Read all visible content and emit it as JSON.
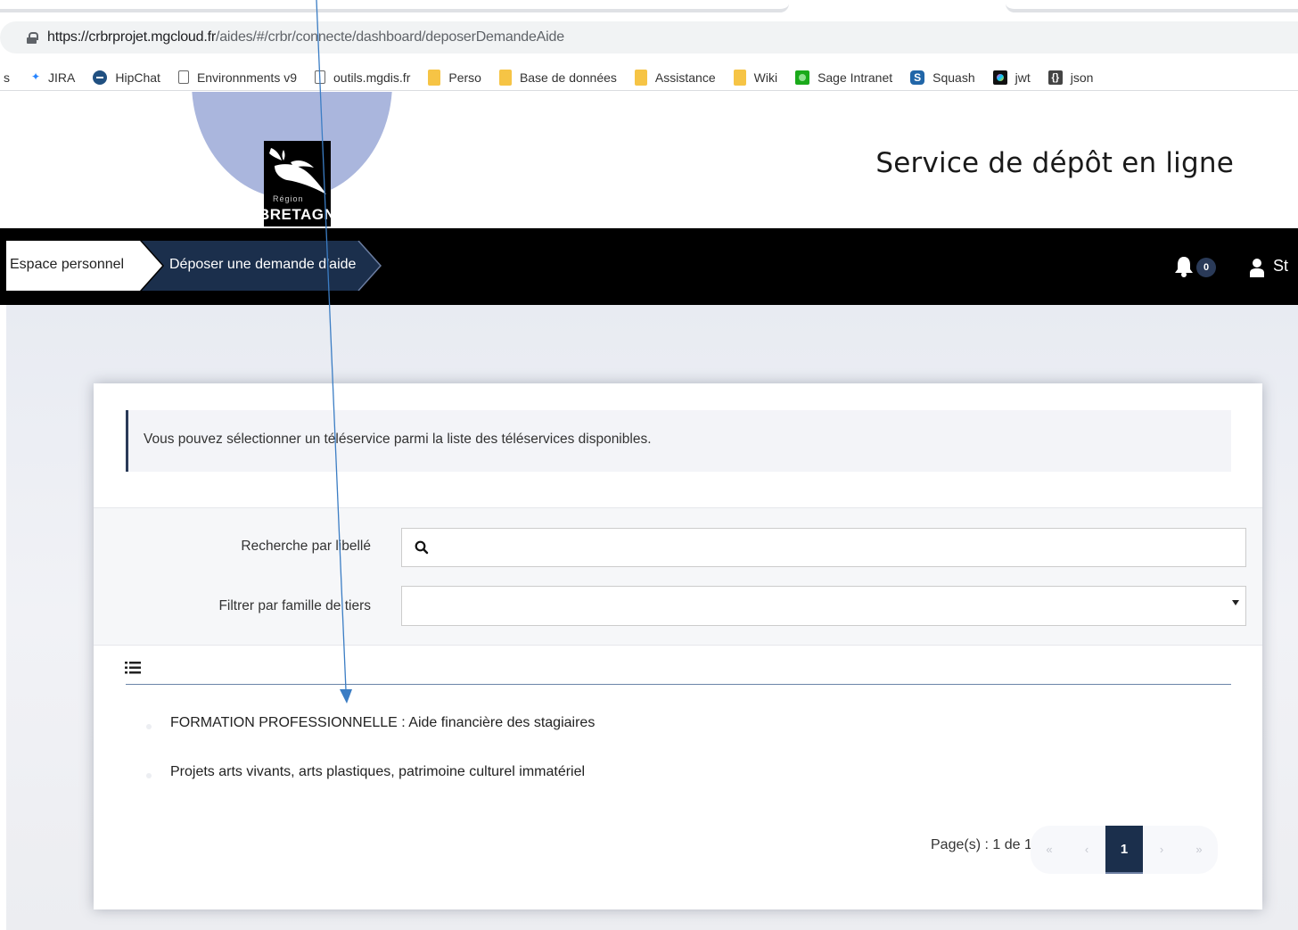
{
  "browser": {
    "url_host": "https://crbrprojet.mgcloud.fr",
    "url_path": "/aides/#/crbr/connecte/dashboard/deposerDemandeAide",
    "bookmarks_cut": "s",
    "bookmarks": [
      {
        "label": "JIRA",
        "icon": "jira-icon"
      },
      {
        "label": "HipChat",
        "icon": "hipchat-icon"
      },
      {
        "label": "Environnments v9",
        "icon": "page-icon"
      },
      {
        "label": "outils.mgdis.fr",
        "icon": "page-icon"
      },
      {
        "label": "Perso",
        "icon": "folder-icon"
      },
      {
        "label": "Base de données",
        "icon": "folder-icon"
      },
      {
        "label": "Assistance",
        "icon": "folder-icon"
      },
      {
        "label": "Wiki",
        "icon": "folder-icon"
      },
      {
        "label": "Sage Intranet",
        "icon": "sage-icon"
      },
      {
        "label": "Squash",
        "icon": "squash-icon"
      },
      {
        "label": "jwt",
        "icon": "jwt-icon"
      },
      {
        "label": "json",
        "icon": "json-icon"
      }
    ]
  },
  "header": {
    "logo_small": "Région",
    "logo_big": "BRETAGNE",
    "service_title": "Service de dépôt en ligne"
  },
  "nav": {
    "crumbs": [
      "Espace personnel",
      "Déposer une demande d'aide"
    ],
    "notification_count": "0",
    "user_name": "St"
  },
  "main": {
    "info_text": "Vous pouvez sélectionner un téléservice parmi la liste des téléservices disponibles.",
    "search_label": "Recherche par libellé",
    "search_value": "",
    "filter_label": "Filtrer par famille de tiers",
    "filter_value": "",
    "items": [
      "FORMATION PROFESSIONNELLE : Aide financière des stagiaires",
      "Projets arts vivants, arts plastiques, patrimoine culturel immatériel"
    ],
    "pager": {
      "text": "Page(s) : 1 de 1",
      "first": "«",
      "prev": "‹",
      "current": "1",
      "next": "›",
      "last": "»"
    }
  },
  "colors": {
    "navbar": "#000000",
    "active_crumb": "#1b2f4c",
    "annotation_arrow": "#3b7dc4"
  }
}
